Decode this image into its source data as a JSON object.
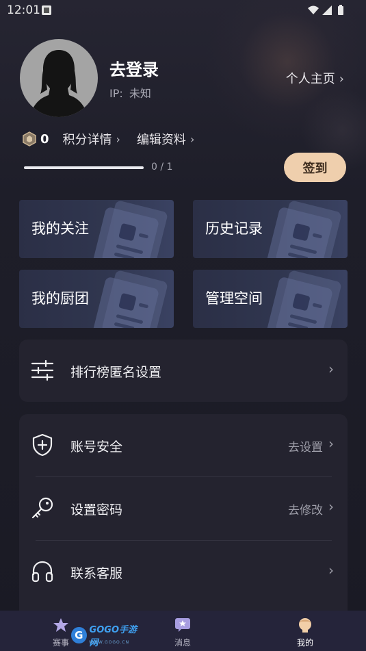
{
  "status_bar": {
    "time": "12:01"
  },
  "profile": {
    "login_text": "去登录",
    "ip_label": "IP:",
    "ip_value": "未知",
    "homepage_label": "个人主页"
  },
  "points": {
    "value": "0",
    "details_label": "积分详情",
    "edit_profile_label": "编辑资料",
    "progress_text": "0 / 1",
    "progress_fraction": 0,
    "signin_label": "签到"
  },
  "cards": [
    {
      "label": "我的关注"
    },
    {
      "label": "历史记录"
    },
    {
      "label": "我的厨团"
    },
    {
      "label": "管理空间"
    }
  ],
  "leaderboard_setting": {
    "label": "排行榜匿名设置"
  },
  "settings": [
    {
      "label": "账号安全",
      "action": "去设置"
    },
    {
      "label": "设置密码",
      "action": "去修改"
    },
    {
      "label": "联系客服",
      "action": ""
    }
  ],
  "bottom_nav": [
    {
      "label": "赛事"
    },
    {
      "label": "消息"
    },
    {
      "label": "我的"
    }
  ],
  "watermark": {
    "text": "GOGO手游网",
    "sub": "WWW.GOGO.CN",
    "letter": "G"
  },
  "colors": {
    "signin_bg": "#efcfad",
    "background": "#1c1c26",
    "panel": "#24232f",
    "card": "#30364f"
  }
}
